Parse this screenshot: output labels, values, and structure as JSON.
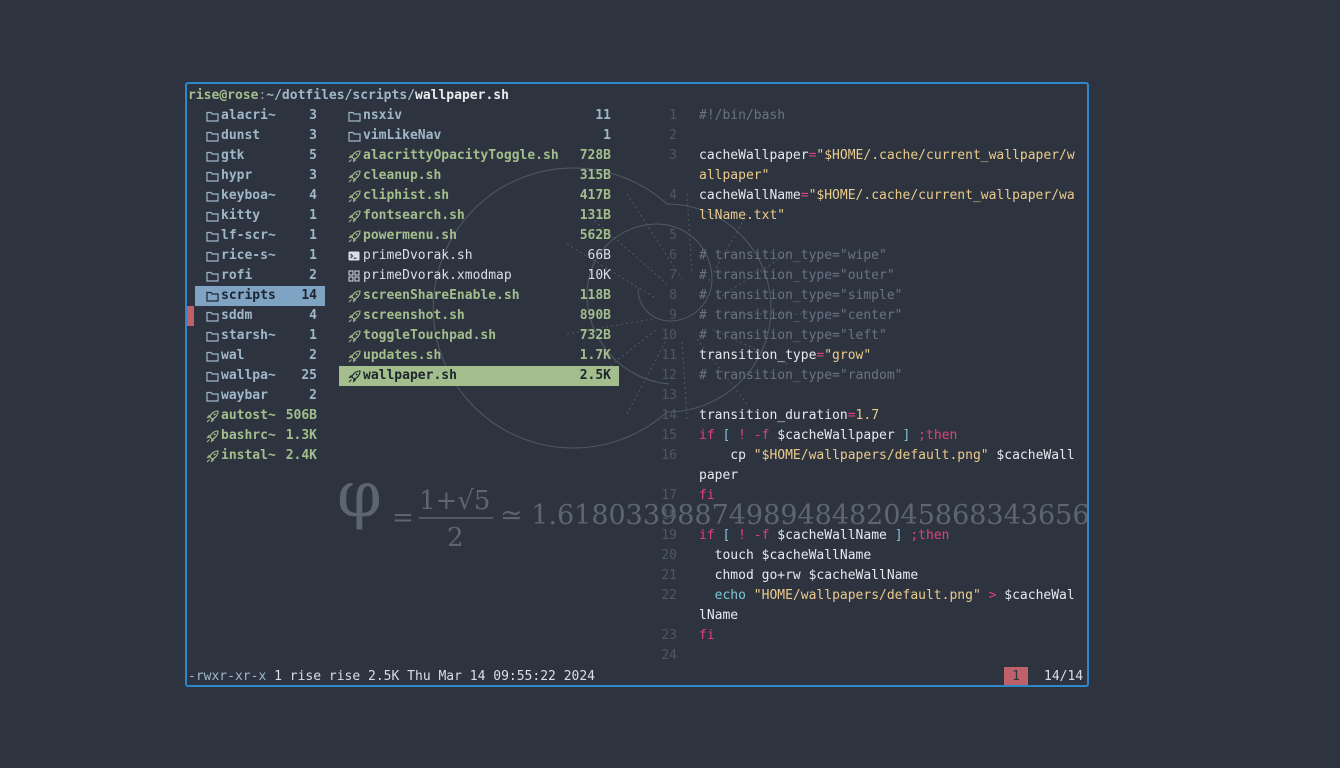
{
  "title": {
    "user": "rise",
    "at": "@",
    "host": "rose",
    "colon": ":",
    "path": "~/dotfiles/scripts/",
    "file": "wallpaper.sh"
  },
  "parent": [
    {
      "icon": "folder-icon",
      "name": "alacri~",
      "size": "3",
      "type": "dir"
    },
    {
      "icon": "folder-icon",
      "name": "dunst",
      "size": "3",
      "type": "dir"
    },
    {
      "icon": "folder-icon",
      "name": "gtk",
      "size": "5",
      "type": "dir"
    },
    {
      "icon": "folder-icon",
      "name": "hypr",
      "size": "3",
      "type": "dir"
    },
    {
      "icon": "folder-icon",
      "name": "keyboa~",
      "size": "4",
      "type": "dir"
    },
    {
      "icon": "folder-icon",
      "name": "kitty",
      "size": "1",
      "type": "dir"
    },
    {
      "icon": "folder-icon",
      "name": "lf-scr~",
      "size": "1",
      "type": "dir"
    },
    {
      "icon": "folder-icon",
      "name": "rice-s~",
      "size": "1",
      "type": "dir"
    },
    {
      "icon": "folder-icon",
      "name": "rofi",
      "size": "2",
      "type": "dir"
    },
    {
      "icon": "folder-icon",
      "name": "scripts",
      "size": "14",
      "type": "dir",
      "selected": true
    },
    {
      "icon": "folder-icon",
      "name": "sddm",
      "size": "4",
      "type": "dir"
    },
    {
      "icon": "folder-icon",
      "name": "starsh~",
      "size": "1",
      "type": "dir"
    },
    {
      "icon": "folder-icon",
      "name": "wal",
      "size": "2",
      "type": "dir"
    },
    {
      "icon": "folder-icon",
      "name": "wallpa~",
      "size": "25",
      "type": "dir"
    },
    {
      "icon": "folder-icon",
      "name": "waybar",
      "size": "2",
      "type": "dir"
    },
    {
      "icon": "rocket-icon",
      "name": "autost~",
      "size": "506B",
      "type": "exe"
    },
    {
      "icon": "rocket-icon",
      "name": "bashrc~",
      "size": "1.3K",
      "type": "exe"
    },
    {
      "icon": "rocket-icon",
      "name": "instal~",
      "size": "2.4K",
      "type": "exe"
    }
  ],
  "current": [
    {
      "icon": "folder-icon",
      "name": "nsxiv",
      "size": "11",
      "type": "dir"
    },
    {
      "icon": "folder-icon",
      "name": "vimLikeNav",
      "size": "1",
      "type": "dir"
    },
    {
      "icon": "rocket-icon",
      "name": "alacrittyOpacityToggle.sh",
      "size": "728B",
      "type": "exe"
    },
    {
      "icon": "rocket-icon",
      "name": "cleanup.sh",
      "size": "315B",
      "type": "exe"
    },
    {
      "icon": "rocket-icon",
      "name": "cliphist.sh",
      "size": "417B",
      "type": "exe"
    },
    {
      "icon": "rocket-icon",
      "name": "fontsearch.sh",
      "size": "131B",
      "type": "exe"
    },
    {
      "icon": "rocket-icon",
      "name": "powermenu.sh",
      "size": "562B",
      "type": "exe"
    },
    {
      "icon": "terminal-file-icon",
      "name": "primeDvorak.sh",
      "size": "66B",
      "type": "plain"
    },
    {
      "icon": "grid-file-icon",
      "name": "primeDvorak.xmodmap",
      "size": "10K",
      "type": "plain"
    },
    {
      "icon": "rocket-icon",
      "name": "screenShareEnable.sh",
      "size": "118B",
      "type": "exe"
    },
    {
      "icon": "rocket-icon",
      "name": "screenshot.sh",
      "size": "890B",
      "type": "exe"
    },
    {
      "icon": "rocket-icon",
      "name": "toggleTouchpad.sh",
      "size": "732B",
      "type": "exe"
    },
    {
      "icon": "rocket-icon",
      "name": "updates.sh",
      "size": "1.7K",
      "type": "exe"
    },
    {
      "icon": "rocket-icon",
      "name": "wallpaper.sh",
      "size": "2.5K",
      "type": "exe",
      "selected": true
    }
  ],
  "preview": [
    {
      "n": "1",
      "parts": [
        [
          "k-comment",
          "#!/bin/bash"
        ]
      ]
    },
    {
      "n": "2",
      "parts": []
    },
    {
      "n": "3",
      "parts": [
        [
          "",
          "cacheWallpaper"
        ],
        [
          "k-op",
          "="
        ],
        [
          "k-str",
          "\"$HOME"
        ],
        [
          "k-str",
          "/.cache/current_wallpaper/w"
        ]
      ]
    },
    {
      "n": "",
      "parts": [
        [
          "k-str",
          "allpaper\""
        ]
      ]
    },
    {
      "n": "4",
      "parts": [
        [
          "",
          "cacheWallName"
        ],
        [
          "k-op",
          "="
        ],
        [
          "k-str",
          "\"$HOME"
        ],
        [
          "k-str",
          "/.cache/current_wallpaper/wa"
        ]
      ]
    },
    {
      "n": "",
      "parts": [
        [
          "k-str",
          "llName.txt\""
        ]
      ]
    },
    {
      "n": "5",
      "parts": []
    },
    {
      "n": "6",
      "parts": [
        [
          "k-comment",
          "# transition_type=\"wipe\""
        ]
      ]
    },
    {
      "n": "7",
      "parts": [
        [
          "k-comment",
          "# transition_type=\"outer\""
        ]
      ]
    },
    {
      "n": "8",
      "parts": [
        [
          "k-comment",
          "# transition_type=\"simple\""
        ]
      ]
    },
    {
      "n": "9",
      "parts": [
        [
          "k-comment",
          "# transition_type=\"center\""
        ]
      ]
    },
    {
      "n": "10",
      "parts": [
        [
          "k-comment",
          "# transition_type=\"left\""
        ]
      ]
    },
    {
      "n": "11",
      "parts": [
        [
          "",
          "transition_type"
        ],
        [
          "k-op",
          "="
        ],
        [
          "k-str",
          "\"grow\""
        ]
      ]
    },
    {
      "n": "12",
      "parts": [
        [
          "k-comment",
          "# transition_type=\"random\""
        ]
      ]
    },
    {
      "n": "13",
      "parts": []
    },
    {
      "n": "14",
      "parts": [
        [
          "",
          "transition_duration"
        ],
        [
          "k-op",
          "="
        ],
        [
          "k-num",
          "1.7"
        ]
      ]
    },
    {
      "n": "15",
      "parts": [
        [
          "k-kw",
          "if"
        ],
        [
          "",
          " "
        ],
        [
          "k-bracket",
          "["
        ],
        [
          "",
          " "
        ],
        [
          "k-op",
          "!"
        ],
        [
          "",
          " "
        ],
        [
          "k-op",
          "-f"
        ],
        [
          "",
          " $cacheWallpaper "
        ],
        [
          "k-bracket",
          "]"
        ],
        [
          "",
          " "
        ],
        [
          "k-kw",
          ";then"
        ]
      ]
    },
    {
      "n": "16",
      "parts": [
        [
          "",
          "    cp "
        ],
        [
          "k-str",
          "\"$HOME"
        ],
        [
          "k-str",
          "/wallpapers/default.png\""
        ],
        [
          "",
          " $cacheWall"
        ]
      ]
    },
    {
      "n": "",
      "parts": [
        [
          "",
          "paper"
        ]
      ]
    },
    {
      "n": "17",
      "parts": [
        [
          "k-kw",
          "fi"
        ]
      ]
    },
    {
      "n": "18",
      "parts": []
    },
    {
      "n": "19",
      "parts": [
        [
          "k-kw",
          "if"
        ],
        [
          "",
          " "
        ],
        [
          "k-bracket",
          "["
        ],
        [
          "",
          " "
        ],
        [
          "k-op",
          "!"
        ],
        [
          "",
          " "
        ],
        [
          "k-op",
          "-f"
        ],
        [
          "",
          " $cacheWallName "
        ],
        [
          "k-bracket",
          "]"
        ],
        [
          "",
          " "
        ],
        [
          "k-kw",
          ";then"
        ]
      ]
    },
    {
      "n": "20",
      "parts": [
        [
          "",
          "  touch $cacheWallName"
        ]
      ]
    },
    {
      "n": "21",
      "parts": [
        [
          "",
          "  chmod go+rw $cacheWallName"
        ]
      ]
    },
    {
      "n": "22",
      "parts": [
        [
          "",
          "  "
        ],
        [
          "k-cmd",
          "echo"
        ],
        [
          "",
          " "
        ],
        [
          "k-str",
          "\"HOME/wallpapers/default.png\""
        ],
        [
          "",
          " "
        ],
        [
          "k-op",
          ">"
        ],
        [
          "",
          " $cacheWal"
        ]
      ]
    },
    {
      "n": "",
      "parts": [
        [
          "",
          "lName"
        ]
      ]
    },
    {
      "n": "23",
      "parts": [
        [
          "k-kw",
          "fi"
        ]
      ]
    },
    {
      "n": "24",
      "parts": []
    }
  ],
  "status": {
    "perm": "-rwxr-xr-x",
    "info": " 1 rise rise 2.5K Thu Mar 14 09:55:22 2024",
    "tag": "1",
    "position": "14/14"
  },
  "wallpaper": {
    "phi": "φ",
    "eq": "=",
    "num": "1+√5",
    "den": "2",
    "approx": "≃ 1.6180339887498948482045868343656"
  },
  "colors": {
    "accent_border": "#2f86c9",
    "background": "#2d3440",
    "dir": "#9fb7c9",
    "exe": "#a3be8c",
    "selected_dir_bg": "#7fa3c2",
    "selected_file_bg": "#a3be8c",
    "marker": "#bf616a"
  }
}
